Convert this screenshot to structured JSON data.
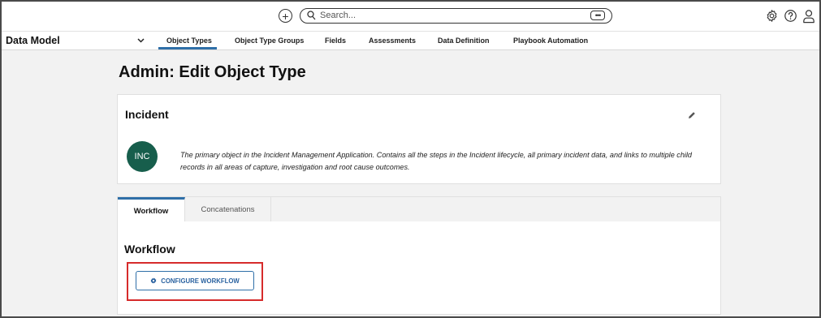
{
  "topbar": {
    "add_icon": "plus-circle-icon",
    "search_placeholder": "Search...",
    "search_more_label": "•••",
    "icons": [
      "gear-icon",
      "help-icon",
      "user-icon"
    ]
  },
  "nav": {
    "app_title": "Data Model",
    "tabs": [
      {
        "label": "Object Types"
      },
      {
        "label": "Object Type Groups"
      },
      {
        "label": "Fields"
      },
      {
        "label": "Assessments"
      },
      {
        "label": "Data Definition"
      },
      {
        "label": "Playbook Automation"
      }
    ],
    "active_tab": "Object Types"
  },
  "page": {
    "title": "Admin: Edit Object Type"
  },
  "object_card": {
    "name": "Incident",
    "avatar_text": "INC",
    "avatar_color": "#175e4c",
    "description": "The primary object in the Incident Management Application. Contains all the steps in the Incident lifecycle, all primary incident data, and links to multiple child records in all areas of capture, investigation and root cause outcomes."
  },
  "tabs": [
    {
      "label": "Workflow",
      "active": true
    },
    {
      "label": "Concatenations",
      "active": false
    }
  ],
  "workflow_panel": {
    "title": "Workflow",
    "configure_button": "CONFIGURE WORKFLOW"
  },
  "colors": {
    "accent": "#2f6fa8",
    "highlight": "#d62b2b"
  }
}
